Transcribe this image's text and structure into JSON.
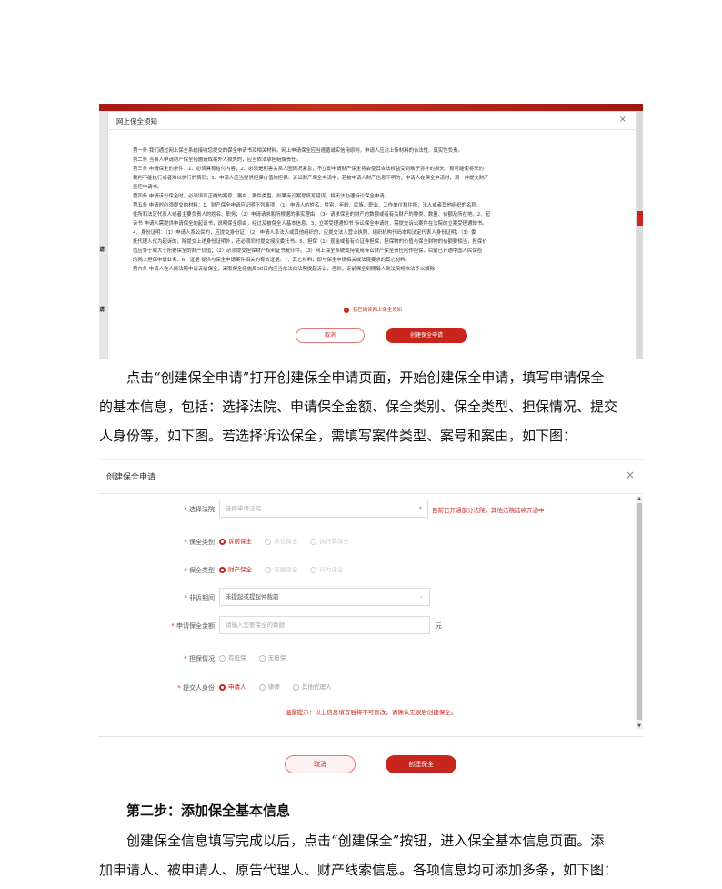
{
  "notice_modal": {
    "title": "网上保全须知",
    "close": "×",
    "left_labels": [
      "请",
      "请"
    ],
    "lines": [
      "第一条  我们通过网上保全系统接收您提交的保全申请书及相关材料。网上申请保全应当遵循诚实信用原则，申请人应对上传材料的合法性、真实性负责。",
      "第二条  当事人申请财产保全措施造成案外人损失的，应当依法承担赔偿责任。",
      "第三条  申请保全的条件：1、必须具有给付内容；2、必须是利害关系人因情况紧急，不立即申请财产保全将会使其合法权益受到难于弥补的损失；有可能使将来的",
      "裁判不能执行或者难以执行的情形；3、申请人应当提供担保价值的担保。诉讼财产保全申请中，若被申请人财产信息不明的，申请人在保全申请时，须一并提交财产",
      "查控申请书。",
      "第四条  申请诉讼保全时，必须填写正确的案号、案由、案件类型。如果诉讼案号填写错误，将无法办理诉讼保全申请。",
      "第五条  申请时必须提交的材料：1、财产保全申请应记明下列事项：（1）申请人的姓名、性别、年龄、民族、职业、工作单位和住所；法人或者其他组织的名称、",
      "住所和法定代表人或者主要负责人的姓名、职务；（2）申请请求和所根据的事实理由；（3）请求保全的财产的数额或者有关财产的种类、数量、价额及所在地。2、起",
      "诉书 申请人需提供申请保全的起诉书，说明保全原由，经过及被保全人基本信息。3、立案受理通知书 诉讼保全申请时，需提交诉讼案件在法院的立案受理通知书。",
      "4、身份证明：（1）申请人系公民的，应提交身份证；（2）申请人系法人或其他组织的，应提交法人营业执照、组织机构代码本和法定代表人身份证明；（3）委",
      "托代理人代为起诉的，除提交上述身份证明外，还必须同时提交授权委托书。5、担保（1）现金或者有价证券担保，担保物的价值与保全财物的价额要相当，担保价",
      "值应等于或大于所要保全的财产价值；（2）必须提交担保财产权利证书复印件。（3）网上保全系统支持使用诉讼财产保全责任险作担保，目前已开通中国人民保险",
      "的网上担保申请业务。6、证据 提供与保全申请案件相关的有效证据。7、其它材料，即与保全申请相关或法院要求的其它材料。",
      "第六条  申请人在人民法院申请诉前保全，采取保全措施后30日内应当依法向法院提起诉讼，否则，诉前保全到期后人民法院将依法予以解除"
    ],
    "agree_text": "我已阅读网上保全须知",
    "cancel": "取消",
    "create": "创建保全申请"
  },
  "para1": [
    "点击“创建保全申请”打开创建保全申请页面，开始创建保全申请，填写申请保全",
    "的基本信息，包括：选择法院、申请保全金额、保全类别、保全类型、担保情况、提交",
    "人身份等，如下图。若选择诉讼保全，需填写案件类型、案号和案由，如下图："
  ],
  "form": {
    "title": "创建保全申请",
    "close": "×",
    "court": {
      "label": "选择法院",
      "placeholder": "选择申请法院",
      "hint": "目前已开通部分法院，其他法院陆续开通中"
    },
    "category": {
      "label": "保全类别",
      "options": [
        "诉前保全",
        "诉讼保全",
        "执行前保全"
      ],
      "selected": "诉前保全"
    },
    "type": {
      "label": "保全类型",
      "options": [
        "财产保全",
        "证据保全",
        "行为保全"
      ],
      "selected": "财产保全"
    },
    "period": {
      "label": "非诉期间",
      "value": "未提起或提起仲裁前"
    },
    "amount": {
      "label": "申请保全金额",
      "placeholder": "请输入您要保全的数额",
      "unit": "元"
    },
    "guarantee": {
      "label": "担保情况",
      "options": [
        "有担保",
        "无担保"
      ]
    },
    "identity": {
      "label": "提交人身份",
      "options": [
        "申请人",
        "律师",
        "其他代理人"
      ],
      "selected": "申请人"
    },
    "tip": "温馨提示：以上信息填写后将不可修改，请确认无误后创建保全。",
    "cancel": "取消",
    "create": "创建保全"
  },
  "heading": "第二步：添加保全基本信息",
  "para2": [
    "创建保全信息填写完成以后，点击“创建保全”按钮，进入保全基本信息页面。添",
    "加申请人、被申请人、原告代理人、财产线索信息。各项信息均可添加多条，如下图："
  ],
  "colors": {
    "accent": "#c8261d"
  }
}
